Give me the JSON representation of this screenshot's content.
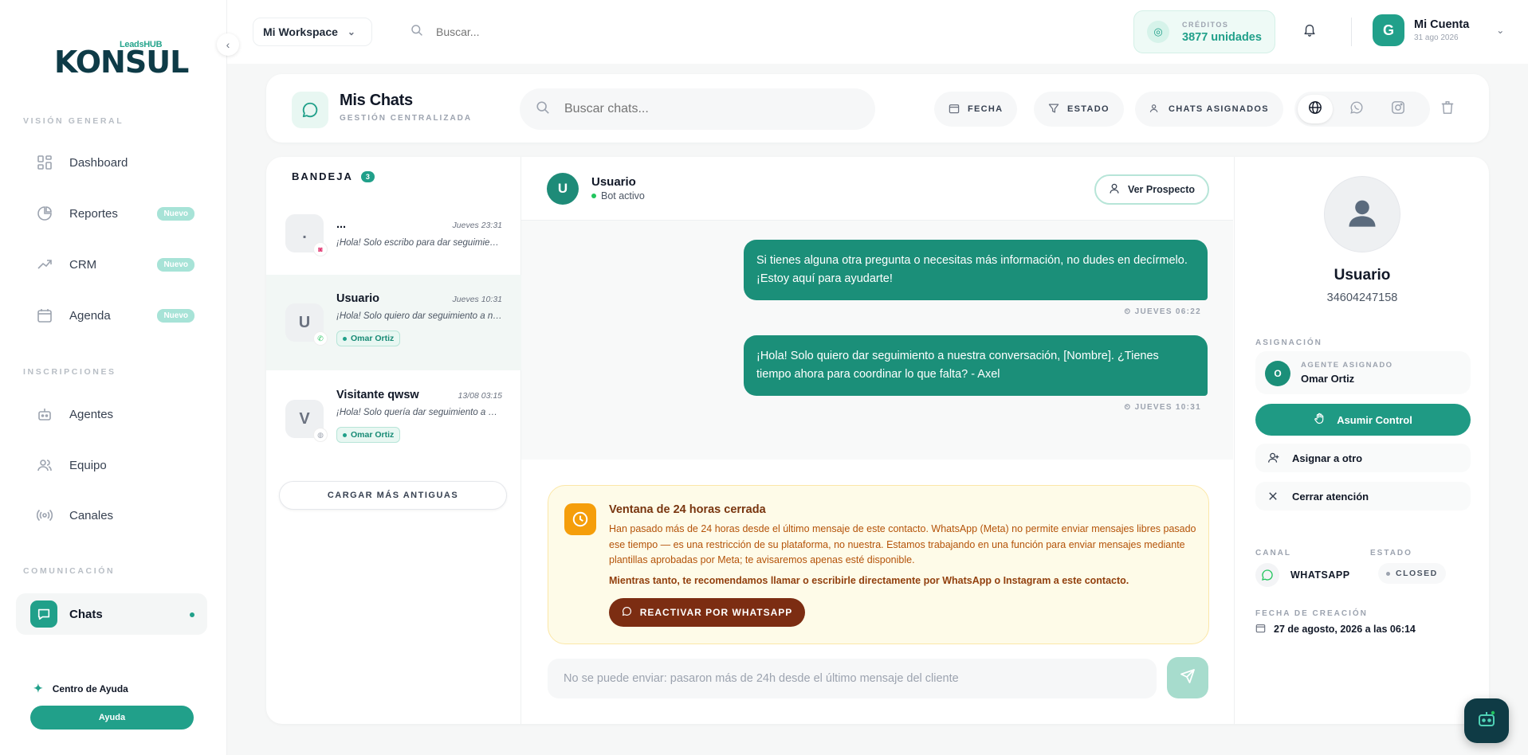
{
  "sidebar": {
    "logo": {
      "top": "LeadsHUB",
      "main": "KONSUL"
    },
    "sections": {
      "overview": "VISIÓN GENERAL",
      "subscriptions": "INSCRIPCIONES",
      "communication": "COMUNICACIÓN"
    },
    "items": [
      {
        "label": "Dashboard",
        "icon": "grid-icon"
      },
      {
        "label": "Reportes",
        "icon": "pie-chart-icon",
        "badge": "Nuevo"
      },
      {
        "label": "CRM",
        "icon": "trending-up-icon",
        "badge": "Nuevo"
      },
      {
        "label": "Agenda",
        "icon": "calendar-icon",
        "badge": "Nuevo"
      },
      {
        "label": "Agentes",
        "icon": "bot-icon"
      },
      {
        "label": "Equipo",
        "icon": "users-icon"
      },
      {
        "label": "Canales",
        "icon": "radio-icon"
      },
      {
        "label": "Chats",
        "icon": "message-icon",
        "active": true
      }
    ],
    "help": {
      "title": "Centro de Ayuda",
      "button": "Ayuda"
    }
  },
  "topbar": {
    "workspace": "Mi Workspace",
    "search_placeholder": "Buscar...",
    "credits": {
      "label": "CRÉDITOS",
      "value": "3877 unidades"
    },
    "account": {
      "name": "Mi Cuenta",
      "date": "31 ago 2026",
      "initial": "G"
    }
  },
  "header": {
    "title": "Mis Chats",
    "subtitle": "GESTIÓN CENTRALIZADA",
    "search_placeholder": "Buscar chats...",
    "filters": {
      "date": "FECHA",
      "status": "ESTADO",
      "assigned": "CHATS ASIGNADOS"
    }
  },
  "inbox": {
    "title": "BANDEJA",
    "count": "3",
    "chats": [
      {
        "avatar": ".",
        "name": "...",
        "time": "Jueves 23:31",
        "message": "¡Hola! Solo escribo para dar seguimiento",
        "channel": "instagram"
      },
      {
        "avatar": "U",
        "name": "Usuario",
        "time": "Jueves 10:31",
        "message": "¡Hola! Solo quiero dar seguimiento a nuestra conversación",
        "tag": "Omar Ortiz",
        "channel": "whatsapp"
      },
      {
        "avatar": "V",
        "name": "Visitante qwsw",
        "time": "13/08 03:15",
        "message": "¡Hola! Solo quería dar seguimiento a nuestra conversación",
        "tag": "Omar Ortiz",
        "channel": "web"
      }
    ],
    "load_more": "CARGAR MÁS ANTIGUAS"
  },
  "conversation": {
    "contact_initial": "U",
    "contact_name": "Usuario",
    "status": "Bot activo",
    "view_prospect": "Ver Prospecto",
    "messages": [
      {
        "text": "Si tienes alguna otra pregunta o necesitas más información, no dudes en decírmelo. ¡Estoy aquí para ayudarte!",
        "time": "JUEVES 06:22"
      },
      {
        "text": "¡Hola! Solo quiero dar seguimiento a nuestra conversación, [Nombre]. ¿Tienes tiempo ahora para coordinar lo que falta? - Axel",
        "time": "JUEVES 10:31"
      }
    ],
    "warning": {
      "title": "Ventana de 24 horas cerrada",
      "body": "Han pasado más de 24 horas desde el último mensaje de este contacto. WhatsApp (Meta) no permite enviar mensajes libres pasado ese tiempo — es una restricción de su plataforma, no nuestra. Estamos trabajando en una función para enviar mensajes mediante plantillas aprobadas por Meta; te avisaremos apenas esté disponible.",
      "recommendation": "Mientras tanto, te recomendamos llamar o escribirle directamente por WhatsApp o Instagram a este contacto.",
      "button": "REACTIVAR POR WHATSAPP"
    },
    "composer_placeholder": "No se puede enviar: pasaron más de 24h desde el último mensaje del cliente"
  },
  "details": {
    "name": "Usuario",
    "phone": "34604247158",
    "assignment_label": "ASIGNACIÓN",
    "agent_label": "AGENTE ASIGNADO",
    "agent_name": "Omar Ortiz",
    "agent_initial": "O",
    "take_control": "Asumir Control",
    "assign_other": "Asignar a otro",
    "close_attention": "Cerrar atención",
    "channel_label": "CANAL",
    "channel_value": "WHATSAPP",
    "status_label": "ESTADO",
    "status_value": "CLOSED",
    "created_label": "FECHA DE CREACIÓN",
    "created_value": "27 de agosto, 2026 a las 06:14"
  },
  "colors": {
    "accent": "#21a08a",
    "warning_bg": "#fefbe8",
    "warning_button": "#7c2d12"
  }
}
